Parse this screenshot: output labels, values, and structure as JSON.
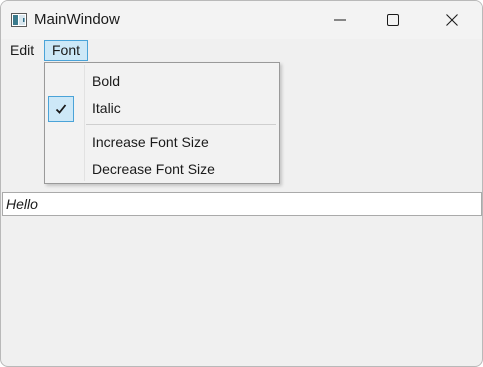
{
  "window": {
    "title": "MainWindow"
  },
  "caption_buttons": {
    "minimize_icon": "minimize-icon",
    "maximize_icon": "maximize-icon",
    "close_icon": "close-icon"
  },
  "menubar": {
    "items": [
      {
        "label": "Edit",
        "active": false
      },
      {
        "label": "Font",
        "active": true
      }
    ]
  },
  "font_menu": {
    "items": [
      {
        "label": "Bold",
        "checked": false
      },
      {
        "label": "Italic",
        "checked": true
      },
      {
        "label": "Increase Font Size",
        "checked": false
      },
      {
        "label": "Decrease Font Size",
        "checked": false
      }
    ]
  },
  "textbox": {
    "value": "Hello",
    "font_style": "italic"
  },
  "colors": {
    "menu_highlight": "#cde8f7",
    "menu_highlight_border": "#4aa3d8",
    "window_background": "#f0f0f0"
  }
}
